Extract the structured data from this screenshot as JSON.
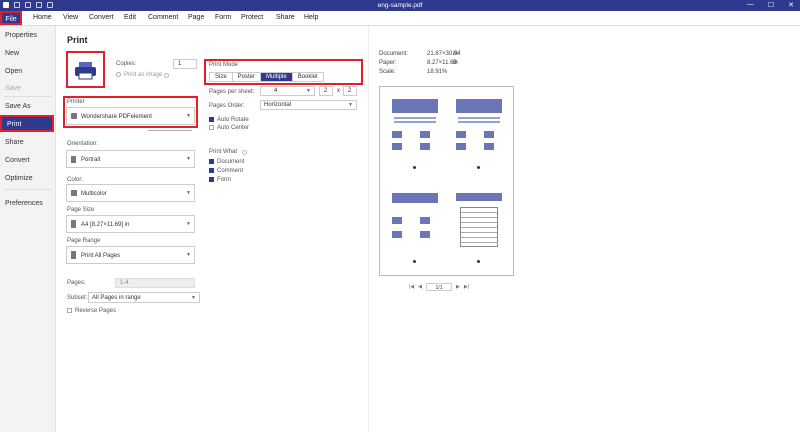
{
  "window": {
    "title": "eng-sample.pdf"
  },
  "menu": [
    "File",
    "Home",
    "View",
    "Convert",
    "Edit",
    "Comment",
    "Page",
    "Form",
    "Protect",
    "Share",
    "Help"
  ],
  "sidebar": {
    "items": [
      "Properties",
      "New",
      "Open",
      "Save",
      "Save As",
      "Print",
      "Share",
      "Convert",
      "Optimize",
      "Preferences"
    ]
  },
  "print": {
    "title": "Print",
    "copies_label": "Copies:",
    "copies_value": "1",
    "print_as_image": "Print as image",
    "printer_label": "Printer",
    "printer_value": "Wondershare PDFelement",
    "orientation_label": "Orientation:",
    "orientation_value": "Portrait",
    "color_label": "Color:",
    "color_value": "Multicolor",
    "page_size_label": "Page Size",
    "page_size_value": "A4 [8.27×11.69] in",
    "page_range_label": "Page Range",
    "page_range_value": "Print All Pages",
    "pages_label": "Pages:",
    "pages_value": "1-4",
    "subset_label": "Subset:",
    "subset_value": "All Pages in range",
    "reverse_pages": "Reverse Pages",
    "print_mode_label": "Print Mode",
    "print_mode_options": [
      "Size",
      "Poster",
      "Multiple",
      "Booklet"
    ],
    "print_mode_selected": "Multiple",
    "pages_per_sheet_label": "Pages per sheet:",
    "pages_per_sheet_value": "4",
    "pages_per_sheet_x": "2",
    "pages_per_sheet_times": "x",
    "pages_per_sheet_y": "2",
    "pages_order_label": "Pages Order:",
    "pages_order_value": "Horizontal",
    "auto_rotate": "Auto Rotate",
    "auto_center": "Auto Center",
    "print_what_label": "Print What",
    "print_what_items": [
      "Document",
      "Comment",
      "Form"
    ]
  },
  "preview": {
    "document_label": "Document:",
    "document_value": "21.87×30.94",
    "document_unit": "in",
    "paper_label": "Paper:",
    "paper_value": "8.27×11.69",
    "paper_unit": "in",
    "scale_label": "Scale:",
    "scale_value": "18.91%",
    "page_input": "1/1"
  }
}
